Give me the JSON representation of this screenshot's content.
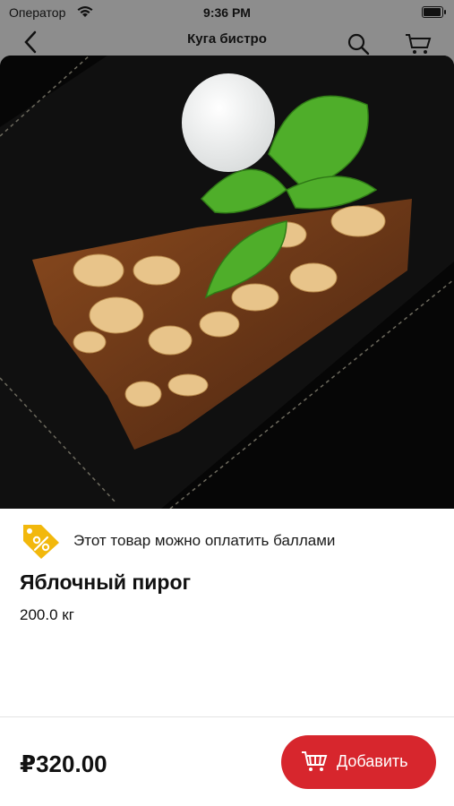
{
  "status_bar": {
    "carrier": "Оператор",
    "time": "9:36 PM"
  },
  "nav": {
    "title": "Куга бистро",
    "icons": [
      "back-chevron-icon",
      "search-icon",
      "cart-icon"
    ]
  },
  "product": {
    "points_note": "Этот товар можно оплатить баллами",
    "title": "Яблочный пирог",
    "weight": "200.0 кг",
    "price": "₽320.00",
    "add_label": "Добавить"
  },
  "colors": {
    "accent": "#d7262d",
    "tag": "#f2b80c",
    "overlay": "#8d8d8d"
  }
}
